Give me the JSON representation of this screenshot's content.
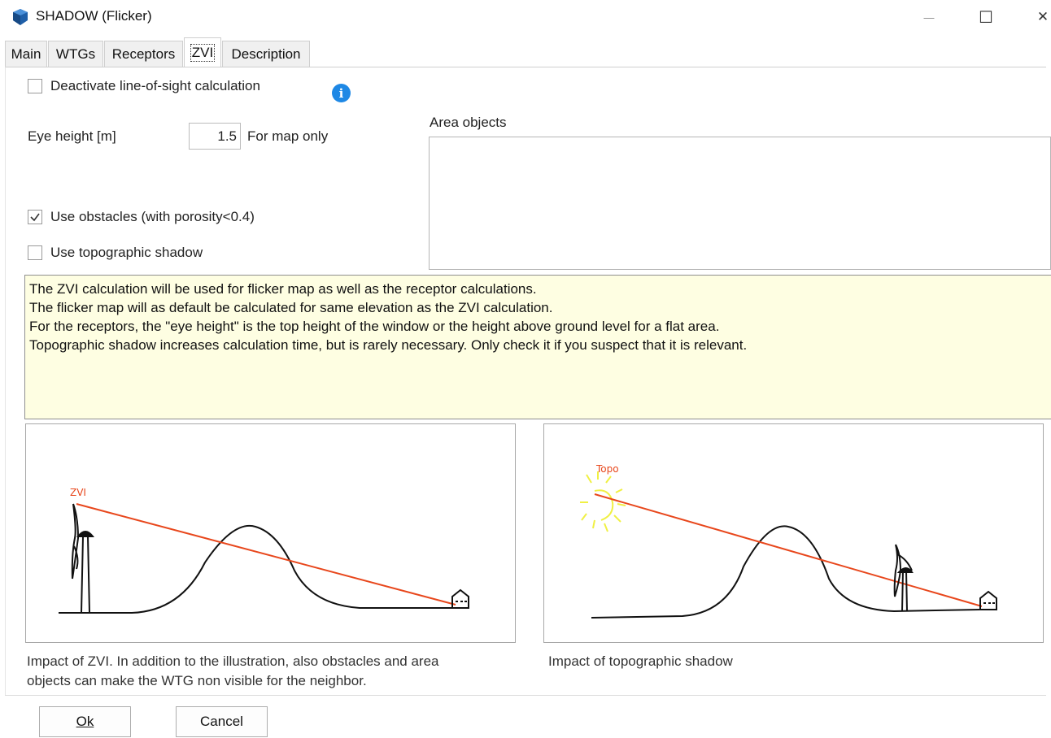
{
  "window": {
    "title": "SHADOW (Flicker)",
    "minimize_glyph": "—",
    "maximize_glyph": "☐",
    "close_glyph": "✕"
  },
  "tabs": [
    {
      "label": "Main"
    },
    {
      "label": "WTGs"
    },
    {
      "label": "Receptors"
    },
    {
      "label": "ZVI",
      "active": true
    },
    {
      "label": "Description"
    }
  ],
  "form": {
    "deactivate_los": {
      "label": "Deactivate line-of-sight calculation",
      "checked": false
    },
    "info_icon_glyph": "i",
    "eye_height_label": "Eye height [m]",
    "eye_height_value": "1.5",
    "eye_height_note": "For map only",
    "use_obstacles": {
      "label": "Use obstacles (with porosity<0.4)",
      "checked": true
    },
    "use_topo": {
      "label": "Use topographic shadow",
      "checked": false
    },
    "area_objects_label": "Area objects"
  },
  "note_lines": [
    "The ZVI calculation will be used for flicker map as well as the receptor calculations.",
    "The flicker map will as default be calculated for same elevation as the ZVI calculation.",
    "For the receptors, the \"eye height\" is the top height of the window or the height above ground level for a flat area.",
    "Topographic shadow increases calculation time, but is rarely necessary. Only check it if you suspect that it is relevant."
  ],
  "illustrations": {
    "zvi_label": "ZVI",
    "topo_label": "Topo",
    "zvi_caption_line1": "Impact of ZVI. In addition to the illustration, also obstacles and area",
    "zvi_caption_line2": "objects can make the WTG non visible for the neighbor.",
    "topo_caption": "Impact of topographic shadow"
  },
  "buttons": {
    "ok": "Ok",
    "cancel": "Cancel"
  },
  "colors": {
    "note_background": "#fefee2",
    "info_icon": "#1e88e5",
    "sight_line": "#e8471c",
    "sun": "#f0f044"
  }
}
